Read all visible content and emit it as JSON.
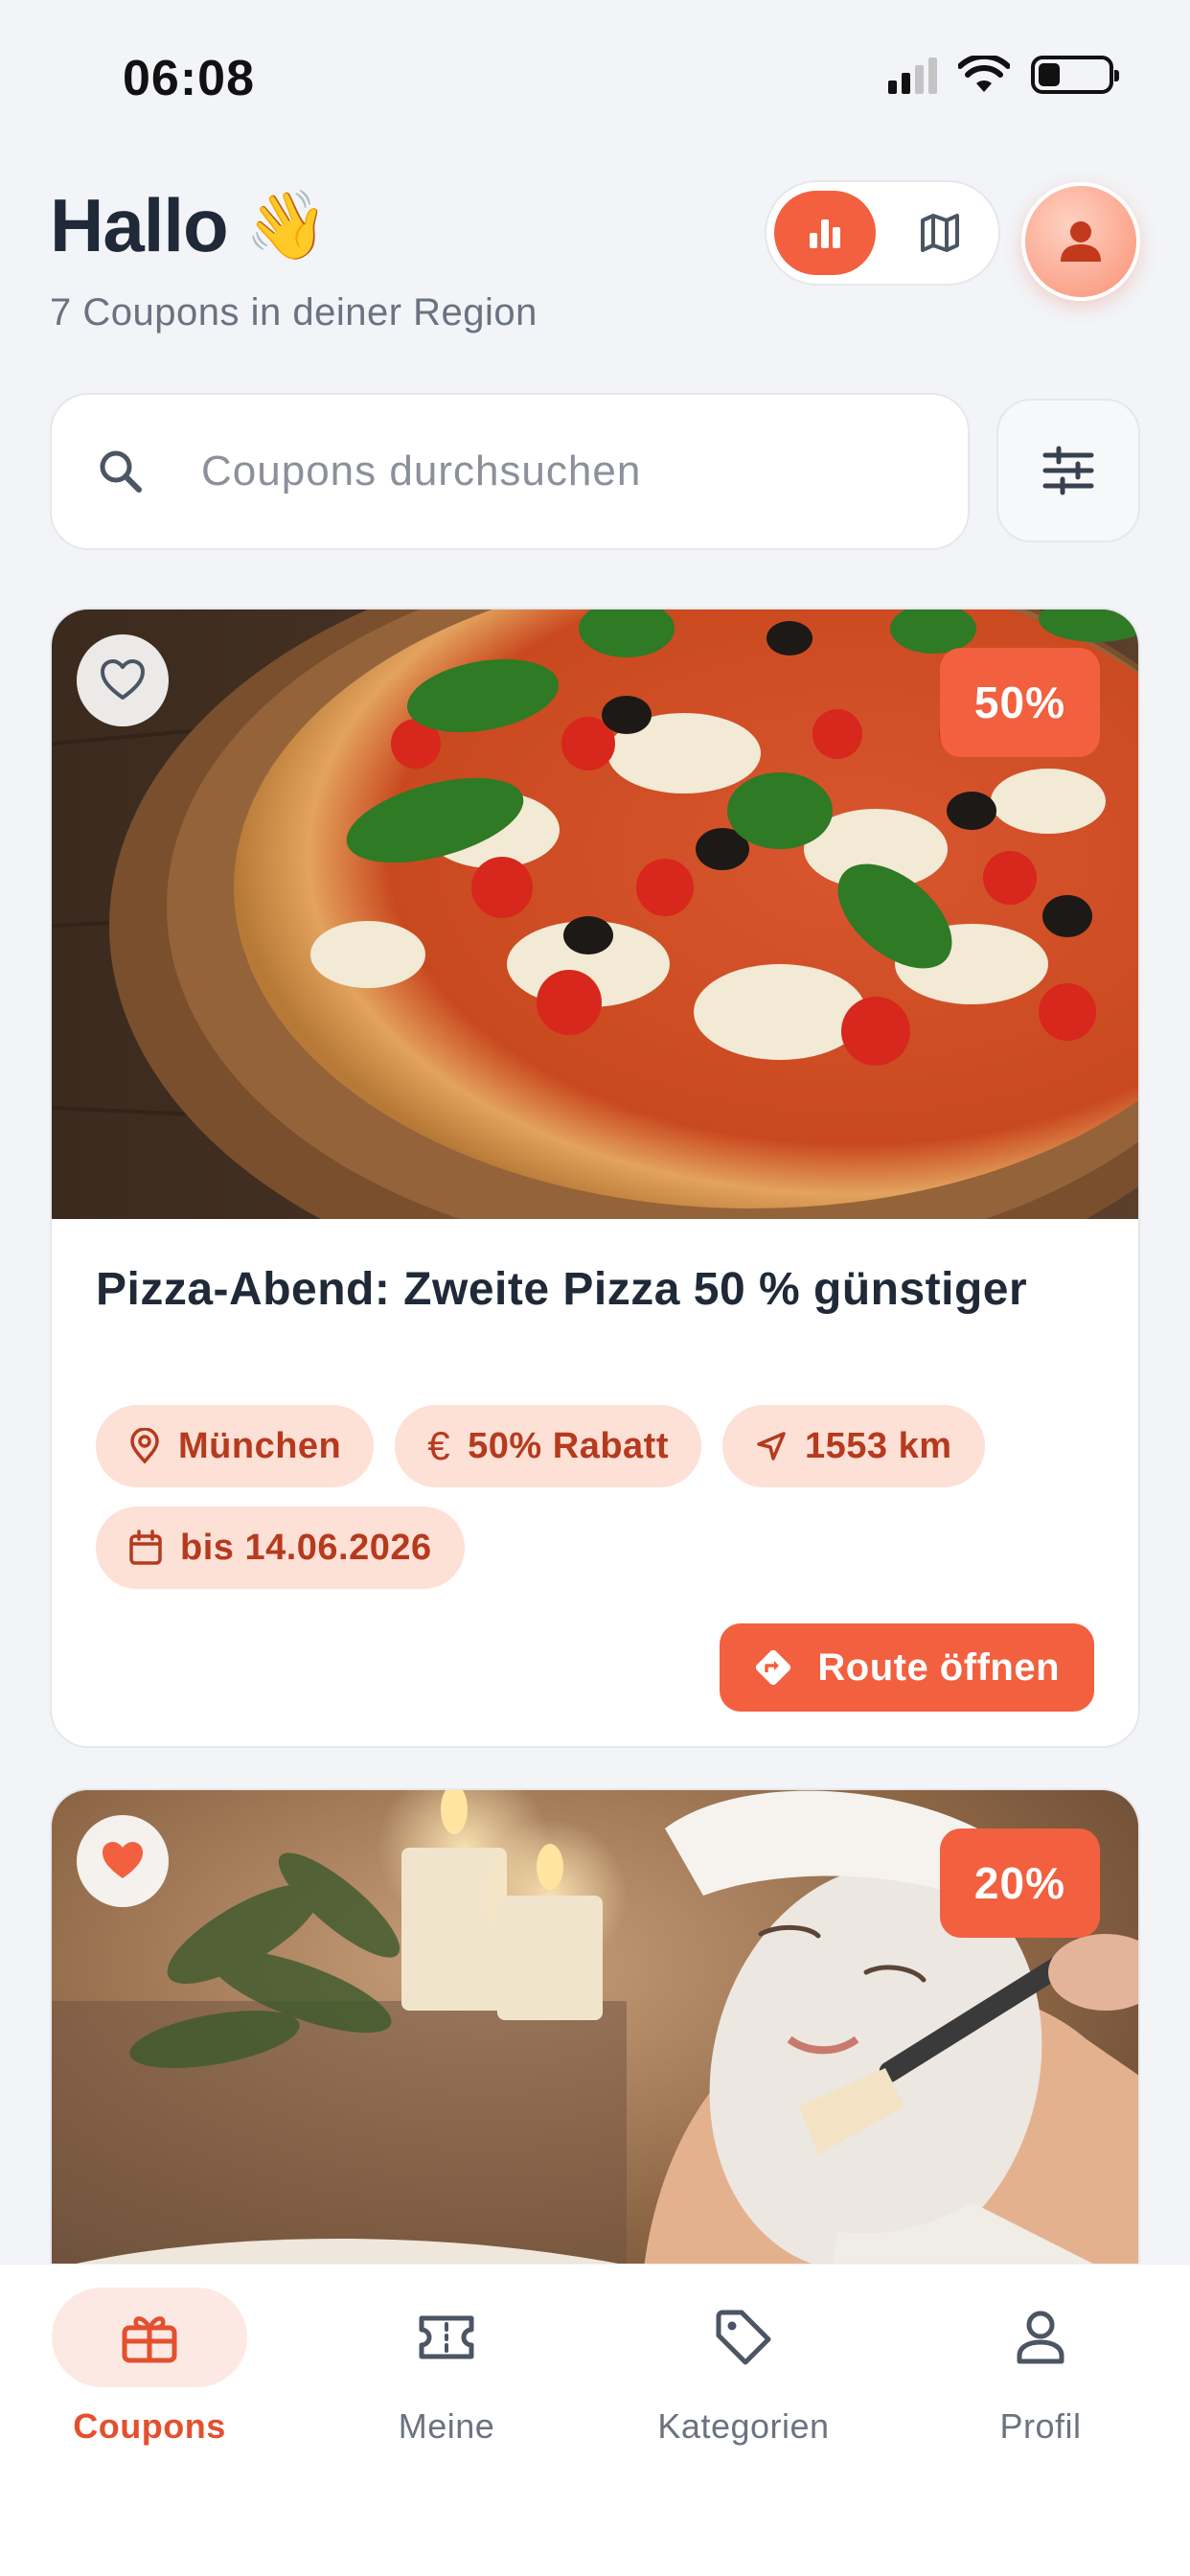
{
  "status_bar": {
    "time": "06:08"
  },
  "header": {
    "greeting": "Hallo",
    "greeting_emoji": "👋",
    "subtitle": "7 Coupons in deiner Region",
    "view_toggle": {
      "active": "chart-icon",
      "inactive": "map-icon"
    },
    "accent_color": "#f2603f"
  },
  "search": {
    "placeholder": "Coupons durchsuchen"
  },
  "coupons": [
    {
      "discount_badge": "50%",
      "favorited": false,
      "title": "Pizza-Abend: Zweite Pizza 50 % günstiger",
      "chips": {
        "location": "München",
        "discount": "50% Rabatt",
        "distance": "1553 km",
        "valid_until": "bis 14.06.2026"
      },
      "route_label": "Route öffnen"
    },
    {
      "discount_badge": "20%",
      "favorited": true
    }
  ],
  "bottom_nav": {
    "items": [
      {
        "label": "Coupons",
        "icon": "gift-icon",
        "active": true
      },
      {
        "label": "Meine",
        "icon": "ticket-icon",
        "active": false
      },
      {
        "label": "Kategorien",
        "icon": "tag-icon",
        "active": false
      },
      {
        "label": "Profil",
        "icon": "user-icon",
        "active": false
      }
    ]
  }
}
